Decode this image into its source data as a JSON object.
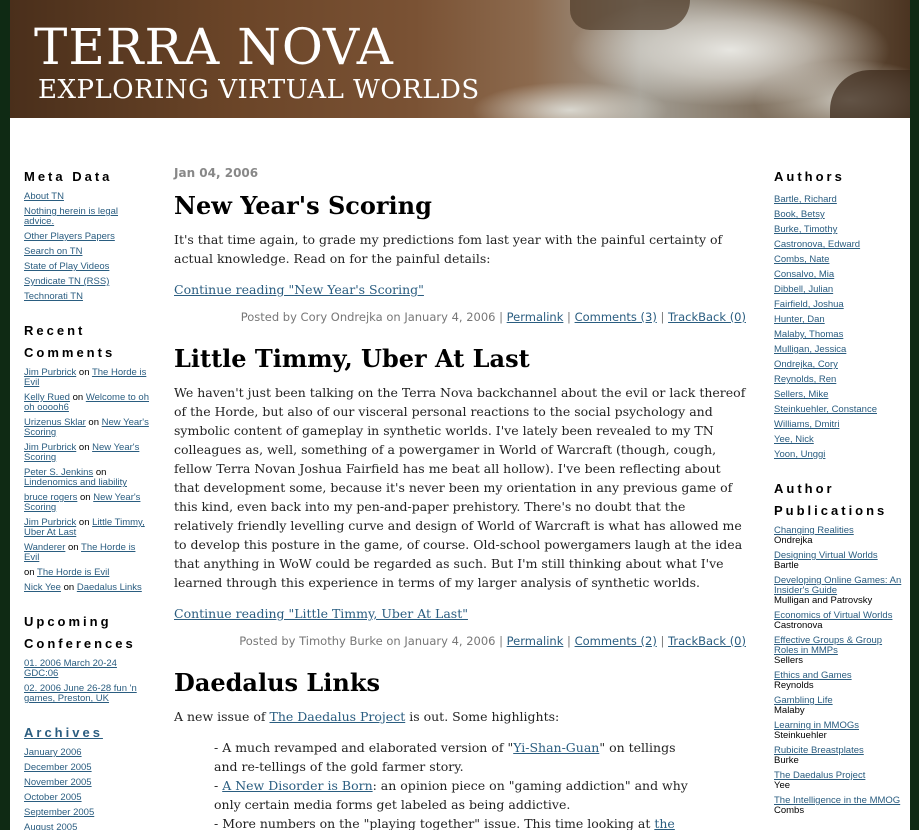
{
  "banner": {
    "title": "TERRA NOVA",
    "subtitle": "EXPLORING VIRTUAL WORLDS"
  },
  "left": {
    "meta_heading": "Meta Data",
    "meta_links": [
      "About TN",
      "Nothing herein is legal advice.",
      "Other Players Papers",
      "Search on TN",
      "State of Play Videos",
      "Syndicate TN (RSS)",
      "Technorati TN"
    ],
    "recent_heading_1": "Recent",
    "recent_heading_2": "Comments",
    "recent": [
      {
        "who": "Jim Purbrick",
        "on": "on",
        "post": "The Horde is Evil"
      },
      {
        "who": "Kelly Rued",
        "on": "on",
        "post": "Welcome to oh oh ooooh6"
      },
      {
        "who": "Urizenus Sklar",
        "on": "on",
        "post": "New Year's Scoring"
      },
      {
        "who": "Jim Purbrick",
        "on": "on",
        "post": "New Year's Scoring"
      },
      {
        "who": "Peter S. Jenkins",
        "on": "on",
        "post": "Lindenomics and liability"
      },
      {
        "who": "bruce rogers",
        "on": "on",
        "post": "New Year's Scoring"
      },
      {
        "who": "Jim Purbrick",
        "on": "on",
        "post": "Little Timmy, Uber At Last"
      },
      {
        "who": "Wanderer",
        "on": "on",
        "post": "The Horde is Evil"
      },
      {
        "who": "",
        "on": "on",
        "post": "The Horde is Evil"
      },
      {
        "who": "Nick Yee",
        "on": "on",
        "post": "Daedalus Links"
      }
    ],
    "upcoming_heading_1": "Upcoming",
    "upcoming_heading_2": "Conferences",
    "conferences": [
      "01. 2006 March 20-24 GDC:06",
      "02. 2006 June 26-28 fun 'n games, Preston, UK"
    ],
    "archives_heading": "Archives",
    "archives": [
      "January 2006",
      "December 2005",
      "November 2005",
      "October 2005",
      "September 2005",
      "August 2005"
    ]
  },
  "main": {
    "date": "Jan 04, 2006",
    "posts": [
      {
        "title": "New Year's Scoring",
        "body": "It's that time again, to grade my predictions fom last year with the painful certainty of actual knowledge. Read on for the painful details:",
        "continue": "Continue reading \"New Year's Scoring\"",
        "posted_prefix": "Posted by Cory Ondrejka on January 4, 2006 |",
        "permalink": "Permalink",
        "sep1": "|",
        "comments": "Comments (3)",
        "sep2": "|",
        "trackback": "TrackBack (0)"
      },
      {
        "title": "Little Timmy, Uber At Last",
        "body": "We haven't just been talking on the Terra Nova backchannel about the evil or lack thereof of the Horde, but also of our visceral personal reactions to the social psychology and symbolic content of gameplay in synthetic worlds. I've lately been revealed to my TN colleagues as, well, something of a powergamer in World of Warcraft (though, cough, fellow Terra Novan Joshua Fairfield has me beat all hollow). I've been reflecting about that development some, because it's never been my orientation in any previous game of this kind, even back into my pen-and-paper prehistory. There's no doubt that the relatively friendly levelling curve and design of World of Warcraft is what has allowed me to develop this posture in the game, of course. Old-school powergamers laugh at the idea that anything in WoW could be regarded as such. But I'm still thinking about what I've learned through this experience in terms of my larger analysis of synthetic worlds.",
        "continue": "Continue reading \"Little Timmy, Uber At Last\"",
        "posted_prefix": "Posted by Timothy Burke on January 4, 2006 |",
        "permalink": "Permalink",
        "sep1": "|",
        "comments": "Comments (2)",
        "sep2": "|",
        "trackback": "TrackBack (0)"
      }
    ],
    "post3": {
      "title": "Daedalus Links",
      "intro_prefix": "A new issue of ",
      "intro_link": "The Daedalus Project",
      "intro_suffix": " is out. Some highlights:",
      "item1_prefix": "- A much revamped and elaborated version of \"",
      "item1_link": "Yi-Shan-Guan",
      "item1_suffix": "\" on tellings and re-tellings of the gold farmer story.",
      "item2_prefix": "- ",
      "item2_link": "A New Disorder is Born",
      "item2_suffix": ": an opinion piece on \"gaming addiction\" and why only certain media forms get labeled as being addictive.",
      "item3_prefix": "- More numbers on the \"playing together\" issue. This time looking at ",
      "item3_link": "the reverse side",
      "item3_suffix": "."
    }
  },
  "right": {
    "authors_heading": "Authors",
    "authors": [
      "Bartle, Richard",
      "Book, Betsy",
      "Burke, Timothy",
      "Castronova, Edward",
      "Combs, Nate",
      "Consalvo, Mia",
      "Dibbell, Julian",
      "Fairfield, Joshua",
      "Hunter, Dan",
      "Malaby, Thomas",
      "Mulligan, Jessica",
      "Ondrejka, Cory",
      "Reynolds, Ren",
      "Sellers, Mike",
      "Steinkuehler, Constance",
      "Williams, Dmitri",
      "Yee, Nick",
      "Yoon, Unggi"
    ],
    "pubs_heading_1": "Author",
    "pubs_heading_2": "Publications",
    "pubs": [
      {
        "title": "Changing Realities",
        "by": "Ondrejka"
      },
      {
        "title": "Designing Virtual Worlds",
        "by": "Bartle"
      },
      {
        "title": "Developing Online Games: An Insider's Guide",
        "by": "Mulligan and Patrovsky"
      },
      {
        "title": "Economics of Virtual Worlds",
        "by": "Castronova"
      },
      {
        "title": "Effective Groups & Group Roles in MMPs",
        "by": "Sellers"
      },
      {
        "title": "Ethics and Games",
        "by": "Reynolds"
      },
      {
        "title": "Gambling Life",
        "by": "Malaby"
      },
      {
        "title": "Learning in MMOGs",
        "by": "Steinkuehler"
      },
      {
        "title": "Rubicite Breastplates",
        "by": "Burke"
      },
      {
        "title": "The Daedalus Project",
        "by": "Yee"
      },
      {
        "title": "The Intelligence in the MMOG",
        "by": "Combs"
      }
    ]
  }
}
